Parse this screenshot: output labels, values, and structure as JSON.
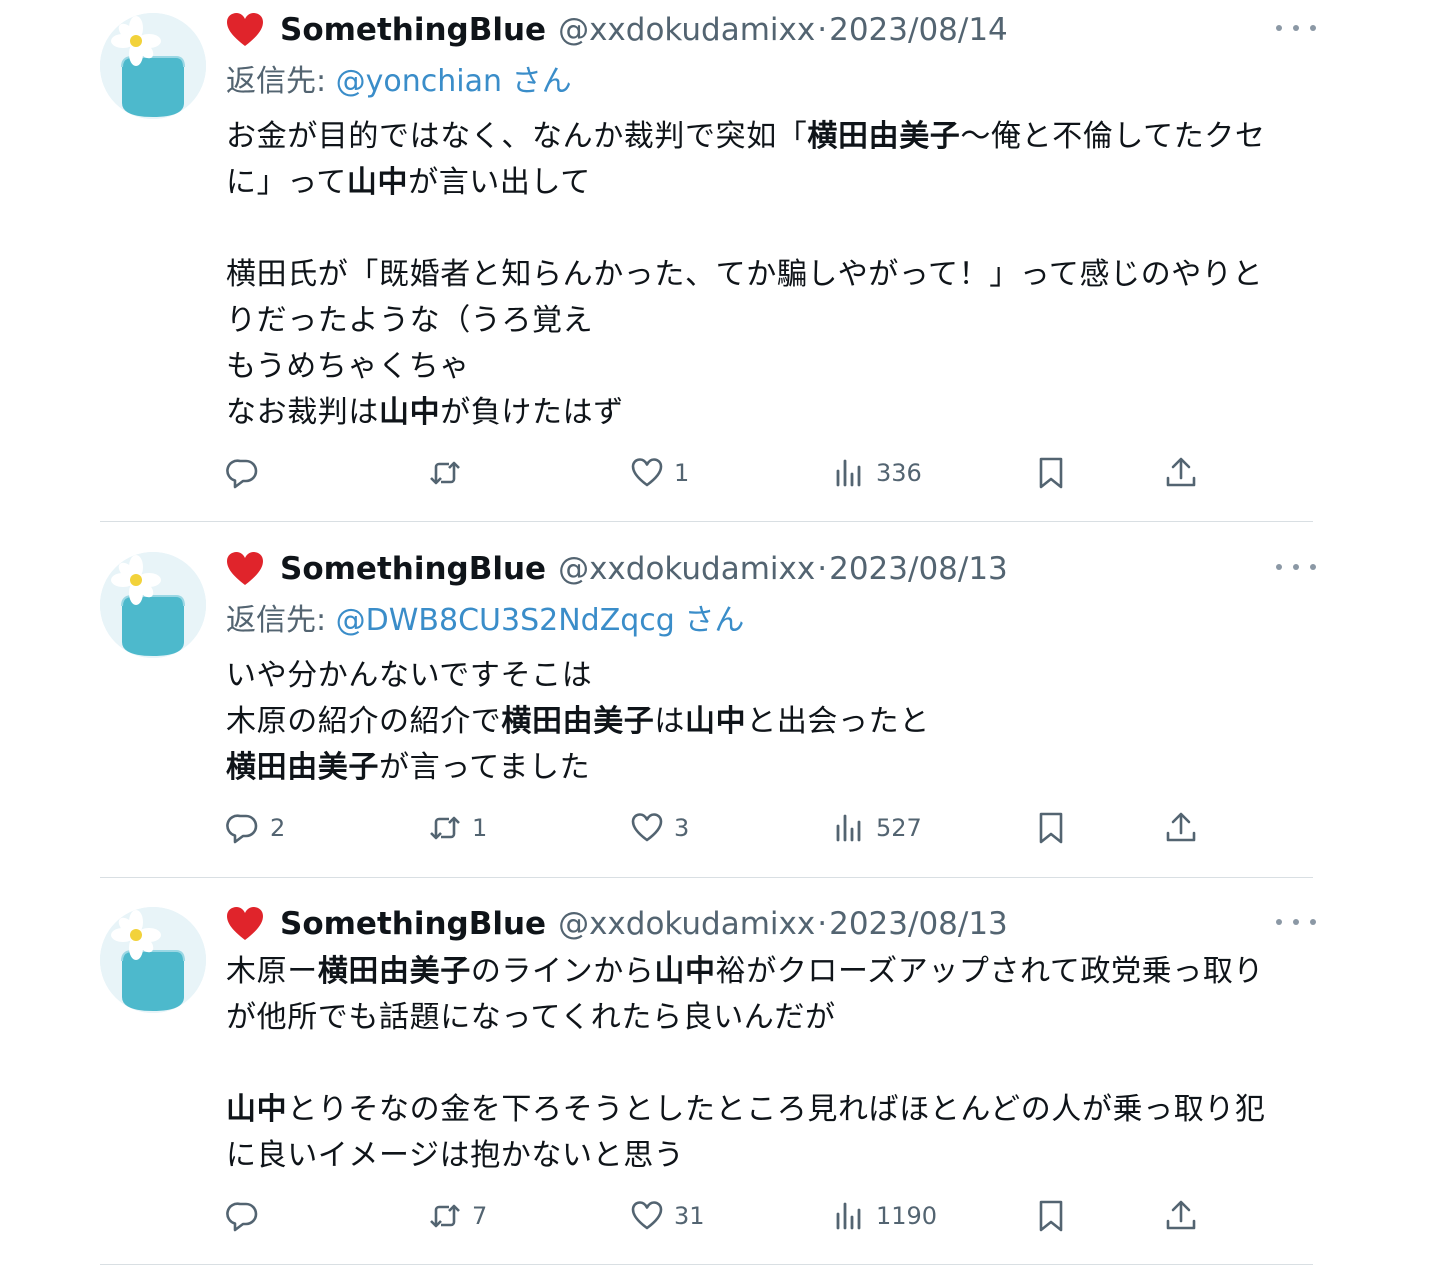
{
  "tweets": [
    {
      "heart": "red-heart-emoji",
      "name": "SomethingBlue",
      "handle": "@xxdokudamixx",
      "dot": "·",
      "date": "2023/08/14",
      "reply_label": "返信先:",
      "reply_mention": "@yonchian",
      "reply_suffix": "さん",
      "lines": [
        [
          {
            "t": "お金が目的ではなく、なんか裁判で突如「"
          },
          {
            "t": "横田由美子",
            "b": true
          },
          {
            "t": "〜俺と不倫してたクセ"
          }
        ],
        [
          {
            "t": "に」って"
          },
          {
            "t": "山中",
            "b": true
          },
          {
            "t": "が言い出して"
          }
        ],
        [],
        [
          {
            "t": "横田氏が「既婚者と知らんかった、てか騙しやがって！」って感じのやりと"
          }
        ],
        [
          {
            "t": "りだったような（うろ覚え"
          }
        ],
        [
          {
            "t": "もうめちゃくちゃ"
          }
        ],
        [
          {
            "t": "なお裁判は"
          },
          {
            "t": "山中",
            "b": true
          },
          {
            "t": "が負けたはず"
          }
        ]
      ],
      "counts": {
        "reply": "",
        "retweet": "",
        "like": "1",
        "views": "336"
      }
    },
    {
      "heart": "red-heart-emoji",
      "name": "SomethingBlue",
      "handle": "@xxdokudamixx",
      "dot": "·",
      "date": "2023/08/13",
      "reply_label": "返信先:",
      "reply_mention": "@DWB8CU3S2NdZqcg",
      "reply_suffix": "さん",
      "lines": [
        [
          {
            "t": "いや分かんないですそこは"
          }
        ],
        [
          {
            "t": "木原の紹介の紹介で"
          },
          {
            "t": "横田由美子",
            "b": true
          },
          {
            "t": "は"
          },
          {
            "t": "山中",
            "b": true
          },
          {
            "t": "と出会ったと"
          }
        ],
        [
          {
            "t": "横田由美子",
            "b": true
          },
          {
            "t": "が言ってました"
          }
        ]
      ],
      "counts": {
        "reply": "2",
        "retweet": "1",
        "like": "3",
        "views": "527"
      }
    },
    {
      "heart": "red-heart-emoji",
      "name": "SomethingBlue",
      "handle": "@xxdokudamixx",
      "dot": "·",
      "date": "2023/08/13",
      "lines": [
        [
          {
            "t": "木原ー"
          },
          {
            "t": "横田由美子",
            "b": true
          },
          {
            "t": "のラインから"
          },
          {
            "t": "山中",
            "b": true
          },
          {
            "t": "裕がクローズアップされて政党乗っ取り"
          }
        ],
        [
          {
            "t": "が他所でも話題になってくれたら良いんだが"
          }
        ],
        [],
        [
          {
            "t": "山中",
            "b": true
          },
          {
            "t": "とりそなの金を下ろそうとしたところ見ればほとんどの人が乗っ取り犯"
          }
        ],
        [
          {
            "t": "に良いイメージは抱かないと思う"
          }
        ]
      ],
      "counts": {
        "reply": "",
        "retweet": "7",
        "like": "31",
        "views": "1190"
      }
    }
  ],
  "icons": {
    "reply": "reply-bubble-icon",
    "retweet": "retweet-icon",
    "like": "heart-outline-icon",
    "views": "bar-chart-icon",
    "bookmark": "bookmark-icon",
    "share": "share-upload-icon",
    "more": "more-dots-icon"
  },
  "colors": {
    "text": "#0f1419",
    "secondary": "#536471",
    "mention": "#3a8dc9",
    "divider": "#d9dfe3",
    "heart": "#e0242b"
  }
}
